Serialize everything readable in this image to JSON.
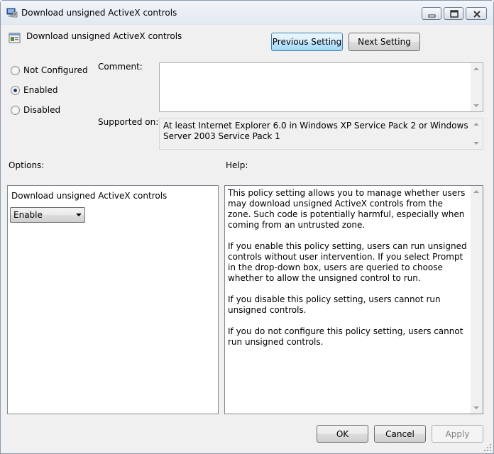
{
  "window": {
    "title": "Download unsigned ActiveX controls"
  },
  "header": {
    "title": "Download unsigned ActiveX controls",
    "previous_label": "Previous Setting",
    "next_label": "Next Setting"
  },
  "state": {
    "options": [
      "Not Configured",
      "Enabled",
      "Disabled"
    ],
    "selected": "Enabled"
  },
  "comment": {
    "label": "Comment:",
    "value": ""
  },
  "supported": {
    "label": "Supported on:",
    "value": "At least Internet Explorer 6.0 in Windows XP Service Pack 2 or Windows Server 2003 Service Pack 1"
  },
  "options_panel": {
    "label": "Options:",
    "setting_label": "Download unsigned ActiveX controls",
    "dropdown_value": "Enable"
  },
  "help_panel": {
    "label": "Help:",
    "paragraphs": [
      "This policy setting allows you to manage whether users may download unsigned ActiveX controls from the zone. Such code is potentially harmful, especially when coming from an untrusted zone.",
      "If you enable this policy setting, users can run unsigned controls without user intervention. If you select Prompt in the drop-down box, users are queried to choose whether to allow the unsigned control to run.",
      "If you disable this policy setting, users cannot run unsigned controls.",
      "If you do not configure this policy setting, users cannot run unsigned controls."
    ]
  },
  "footer": {
    "ok_label": "OK",
    "cancel_label": "Cancel",
    "apply_label": "Apply"
  }
}
